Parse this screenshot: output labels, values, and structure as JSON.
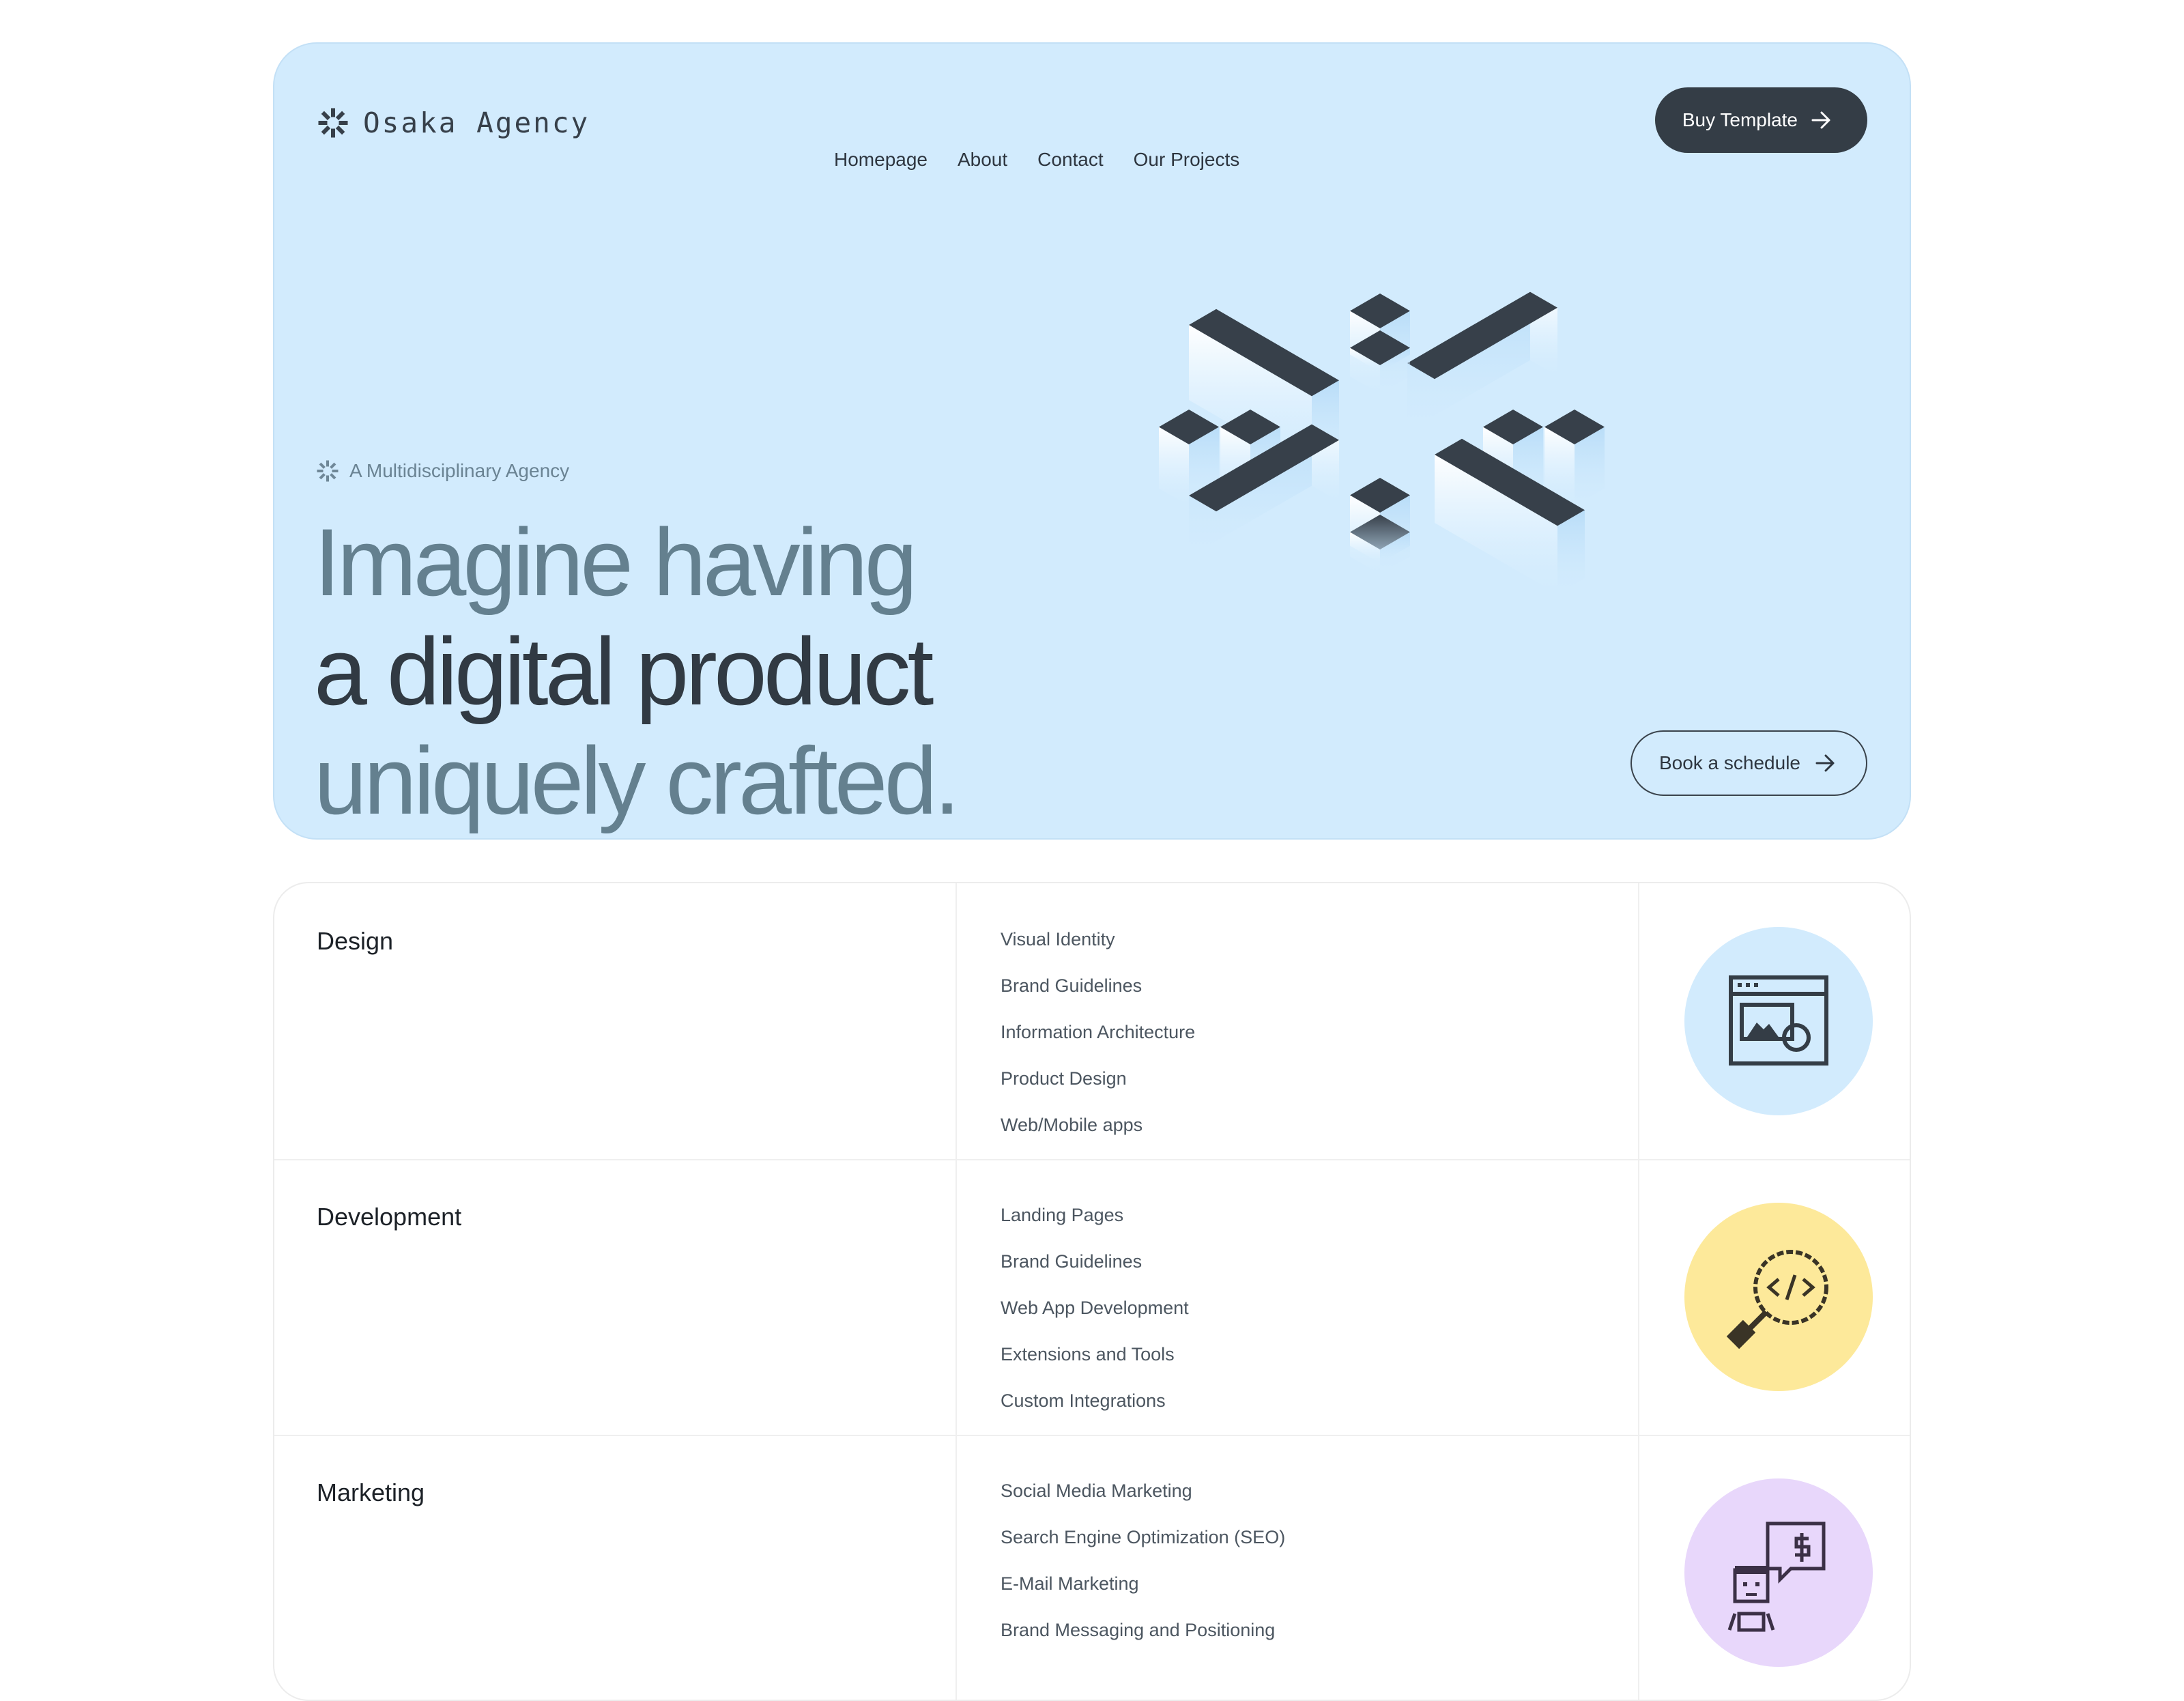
{
  "brand": {
    "name": "Osaka Agency"
  },
  "nav": {
    "items": [
      "Homepage",
      "About",
      "Contact",
      "Our Projects"
    ]
  },
  "header": {
    "cta_label": "Buy Template"
  },
  "hero": {
    "tagline": "A Multidisciplinary Agency",
    "headline": [
      "Imagine having",
      "a digital product",
      "uniquely crafted."
    ],
    "cta_label": "Book a schedule"
  },
  "services": [
    {
      "title": "Design",
      "items": [
        "Visual Identity",
        "Brand Guidelines",
        "Information Architecture",
        "Product Design",
        "Web/Mobile apps"
      ],
      "icon": "browser-image-icon",
      "color": "#d2ebfd"
    },
    {
      "title": "Development",
      "items": [
        "Landing Pages",
        "Brand Guidelines",
        "Web App Development",
        "Extensions and Tools",
        "Custom Integrations"
      ],
      "icon": "code-magnifier-icon",
      "color": "#fde99a"
    },
    {
      "title": "Marketing",
      "items": [
        "Social Media Marketing",
        "Search Engine Optimization (SEO)",
        "E-Mail Marketing",
        "Brand Messaging and Positioning"
      ],
      "icon": "person-money-icon",
      "color": "#e8d7fb"
    }
  ],
  "colors": {
    "hero_bg": "#d2ebfd",
    "dark": "#343d46",
    "muted_text": "#64808f",
    "design_circle": "#d2ebfd",
    "development_circle": "#fde99a",
    "marketing_circle": "#e8d7fb"
  }
}
